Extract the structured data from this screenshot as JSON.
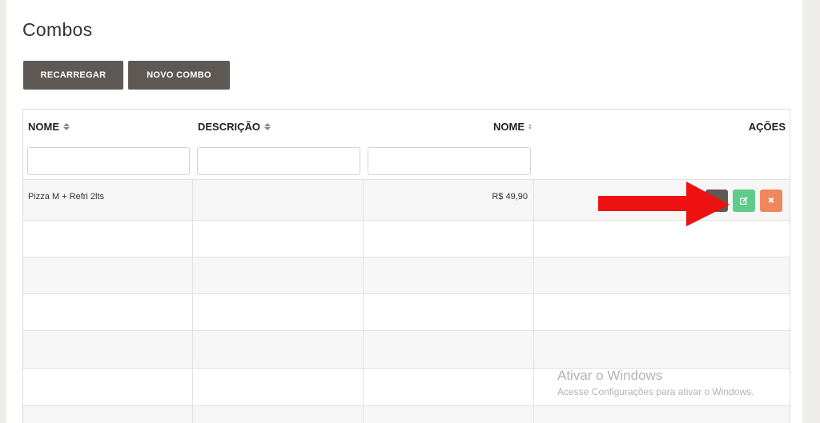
{
  "page": {
    "title": "Combos"
  },
  "toolbar": {
    "reload_label": "RECARREGAR",
    "new_label": "NOVO COMBO"
  },
  "table": {
    "columns": [
      {
        "label": "NOME",
        "sortable": true
      },
      {
        "label": "DESCRIÇÃO",
        "sortable": true
      },
      {
        "label": "NOME",
        "sortable": true
      },
      {
        "label": "AÇÕES",
        "sortable": false
      }
    ],
    "filters": [
      "",
      "",
      ""
    ],
    "rows": [
      {
        "name": "Pizza M + Refri 2lts",
        "description": "",
        "price": "R$ 49,90"
      }
    ]
  },
  "colors": {
    "button_dark": "#5f5955",
    "edit_green": "#5fcb8a",
    "delete_orange": "#f0865e",
    "arrow_red": "#ee1111"
  },
  "watermark": {
    "title": "Ativar o Windows",
    "subtitle": "Acesse Configurações para ativar o Windows."
  }
}
